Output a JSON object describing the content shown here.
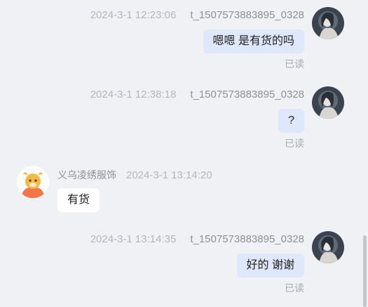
{
  "messages": [
    {
      "time": "2024-3-1 12:23:06",
      "user": "t_1507573883895_0328",
      "text": "嗯嗯 是有货的吗",
      "status": "已读"
    },
    {
      "time": "2024-3-1 12:38:18",
      "user": "t_1507573883895_0328",
      "text": "?",
      "status": "已读"
    },
    {
      "name": "义乌凌绣服饰",
      "time": "2024-3-1 13:14:20",
      "text": "有货"
    },
    {
      "time": "2024-3-1 13:14:35",
      "user": "t_1507573883895_0328",
      "text": "好的 谢谢",
      "status": "已读"
    }
  ]
}
